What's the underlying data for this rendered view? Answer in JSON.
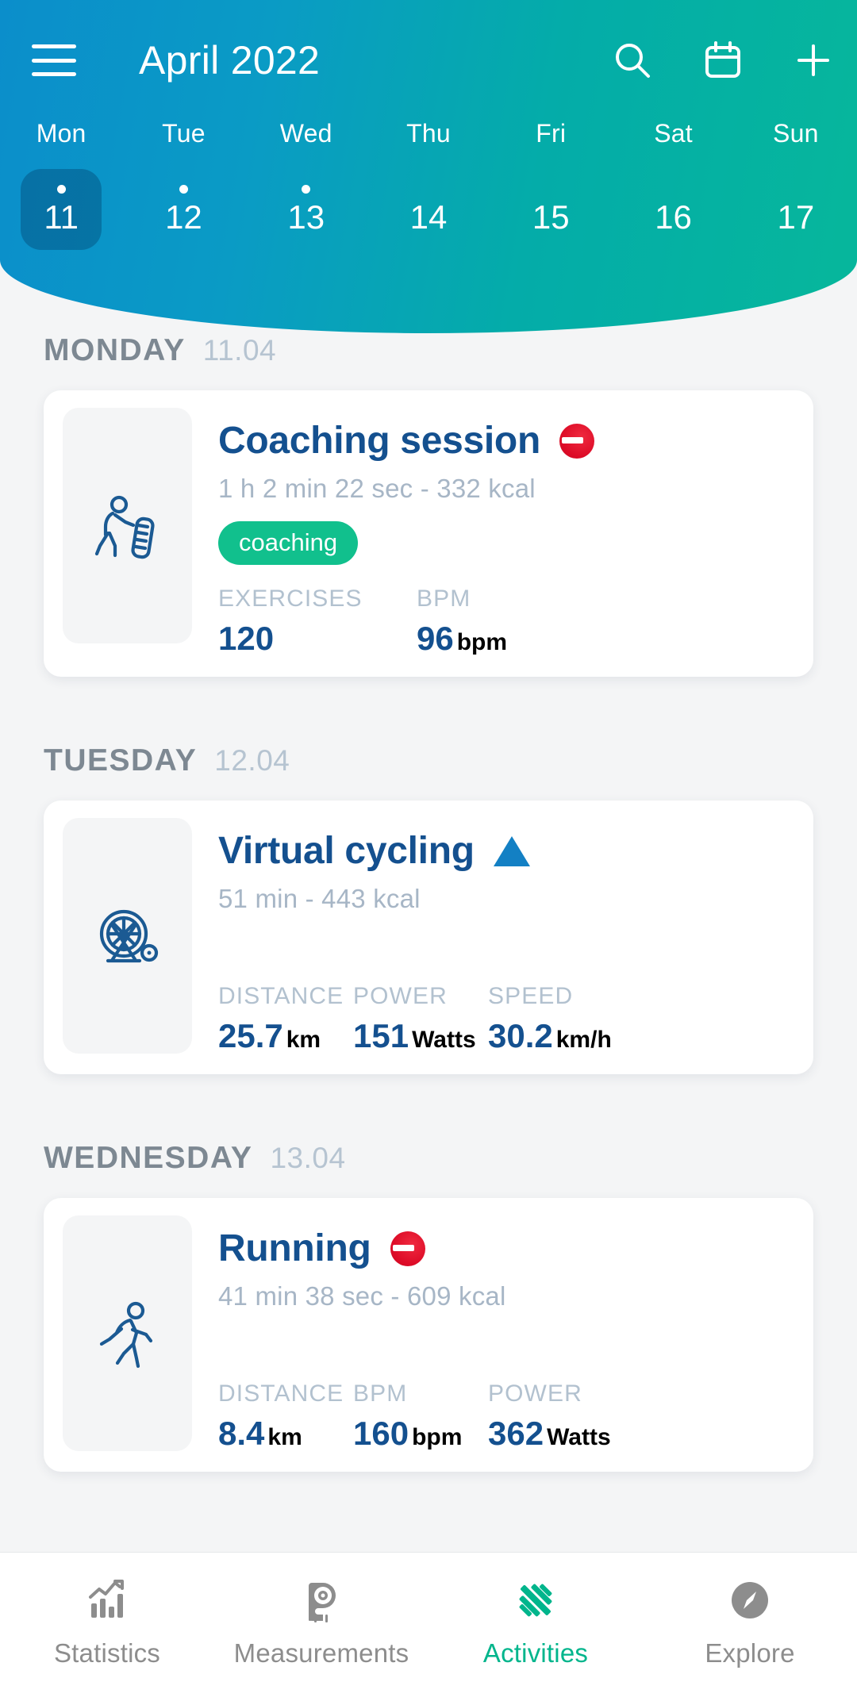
{
  "theme": {
    "gradient_start": "#0b8ecb",
    "gradient_end": "#06b79b",
    "page_bg": "#f4f5f6",
    "card_bg": "#ffffff",
    "primary_text": "#14508f",
    "muted_text": "#a7b6c6",
    "heading_text": "#7d8892",
    "date_text": "#b6c4d1",
    "tag_green": "#11c08d",
    "accent_green": "#00b58c",
    "trend_down_red": "#dd0b27",
    "trend_up_blue": "#1380c4",
    "nav_inactive": "#8d8d8d"
  },
  "header": {
    "menu_icon": "hamburger-menu-icon",
    "title": "April 2022",
    "actions": [
      {
        "name": "search-icon",
        "label": "Search"
      },
      {
        "name": "calendar-icon",
        "label": "Calendar"
      },
      {
        "name": "add-icon",
        "label": "Add activity"
      }
    ]
  },
  "week": {
    "days": [
      {
        "name": "Mon",
        "number": "11",
        "has_activity": true,
        "selected": true
      },
      {
        "name": "Tue",
        "number": "12",
        "has_activity": true,
        "selected": false
      },
      {
        "name": "Wed",
        "number": "13",
        "has_activity": true,
        "selected": false
      },
      {
        "name": "Thu",
        "number": "14",
        "has_activity": false,
        "selected": false
      },
      {
        "name": "Fri",
        "number": "15",
        "has_activity": false,
        "selected": false
      },
      {
        "name": "Sat",
        "number": "16",
        "has_activity": false,
        "selected": false
      },
      {
        "name": "Sun",
        "number": "17",
        "has_activity": false,
        "selected": false
      }
    ]
  },
  "sections": [
    {
      "day_of_week": "MONDAY",
      "date": "11.04",
      "activity": {
        "icon": "tire-push-coaching-icon",
        "title": "Coaching session",
        "trend": "down",
        "summary": "1 h 2 min 22 sec - 332 kcal",
        "tag": "coaching",
        "stats": [
          {
            "label": "EXERCISES",
            "value": "120",
            "unit": ""
          },
          {
            "label": "BPM",
            "value": "96",
            "unit": "bpm"
          }
        ]
      }
    },
    {
      "day_of_week": "TUESDAY",
      "date": "12.04",
      "activity": {
        "icon": "spin-bike-icon",
        "title": "Virtual cycling",
        "trend": "up",
        "summary": "51 min  - 443 kcal",
        "tag": "",
        "stats": [
          {
            "label": "DISTANCE",
            "value": "25.7",
            "unit": "km"
          },
          {
            "label": "POWER",
            "value": "151",
            "unit": "Watts"
          },
          {
            "label": "SPEED",
            "value": "30.2",
            "unit": "km/h"
          }
        ]
      }
    },
    {
      "day_of_week": "WEDNESDAY",
      "date": "13.04",
      "activity": {
        "icon": "running-person-icon",
        "title": "Running",
        "trend": "down",
        "summary": "41 min 38 sec - 609 kcal",
        "tag": "",
        "stats": [
          {
            "label": "DISTANCE",
            "value": "8.4",
            "unit": "km"
          },
          {
            "label": "BPM",
            "value": "160",
            "unit": "bpm"
          },
          {
            "label": "POWER",
            "value": "362",
            "unit": "Watts"
          }
        ]
      }
    }
  ],
  "bottom_nav": {
    "items": [
      {
        "label": "Statistics",
        "icon": "bar-chart-icon",
        "active": false
      },
      {
        "label": "Measurements",
        "icon": "tape-measure-icon",
        "active": false
      },
      {
        "label": "Activities",
        "icon": "dumbbell-icon",
        "active": true
      },
      {
        "label": "Explore",
        "icon": "compass-icon",
        "active": false
      }
    ]
  }
}
